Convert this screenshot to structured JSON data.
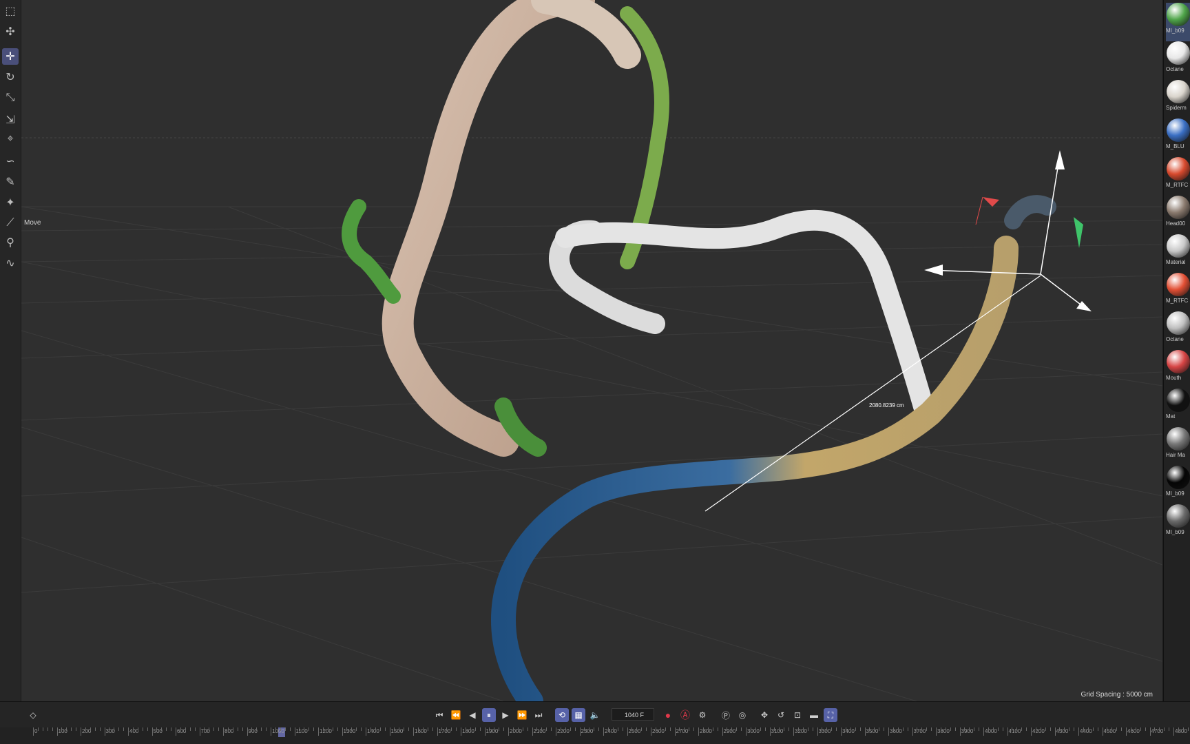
{
  "viewport": {
    "mode_label": "Move",
    "grid_spacing": "Grid Spacing : 5000 cm",
    "measure_readout": "2080.8239 cm"
  },
  "toolbar": {
    "tools": [
      {
        "name": "select-icon",
        "glyph": "⬚"
      },
      {
        "name": "transform-icon",
        "glyph": "✣"
      },
      {
        "name": "move-icon",
        "glyph": "✛",
        "active": true
      },
      {
        "name": "rotate-icon",
        "glyph": "↻"
      },
      {
        "name": "scale-icon",
        "glyph": "⤡"
      },
      {
        "name": "axis-icon",
        "glyph": "⇲"
      },
      {
        "name": "snap-icon",
        "glyph": "⌖"
      },
      {
        "name": "spline-icon",
        "glyph": "∽"
      },
      {
        "name": "pen-icon",
        "glyph": "✎"
      },
      {
        "name": "paint-icon",
        "glyph": "✦"
      },
      {
        "name": "brush-icon",
        "glyph": "⟋"
      },
      {
        "name": "knife-icon",
        "glyph": "⚲"
      },
      {
        "name": "magnet-icon",
        "glyph": "∿"
      }
    ]
  },
  "materials": [
    {
      "label": "MI_b09",
      "color": "#4fa54a",
      "selected": true
    },
    {
      "label": "Octane",
      "color": "#e8e8e8"
    },
    {
      "label": "Spiderm",
      "color": "#d9d4cc"
    },
    {
      "label": "M_BLU",
      "color": "#3a6fc4"
    },
    {
      "label": "M_RTFC",
      "color": "#d84a2e"
    },
    {
      "label": "Head00",
      "color": "#8a7a6e"
    },
    {
      "label": "Material",
      "color": "#c8c8c8"
    },
    {
      "label": "M_RTFC",
      "color": "#e24f34"
    },
    {
      "label": "Octane",
      "color": "#bfbfbf"
    },
    {
      "label": "Mouth",
      "color": "#d64444"
    },
    {
      "label": "Mat",
      "color": "#111111"
    },
    {
      "label": "Hair Ma",
      "color": "#777777"
    },
    {
      "label": "MI_b09",
      "color": "#050505"
    },
    {
      "label": "MI_b09",
      "color": "#6a6a6a"
    }
  ],
  "transport": {
    "frame": "1040 F",
    "buttons": [
      {
        "name": "keyframe-icon",
        "glyph": "◇"
      },
      {
        "name": "go-to-start-icon",
        "glyph": "⏮"
      },
      {
        "name": "prev-key-icon",
        "glyph": "⏪"
      },
      {
        "name": "prev-frame-icon",
        "glyph": "◀"
      },
      {
        "name": "pause-icon",
        "glyph": "⏸",
        "hl": true
      },
      {
        "name": "play-icon",
        "glyph": "▶"
      },
      {
        "name": "next-key-icon",
        "glyph": "⏩"
      },
      {
        "name": "go-to-end-icon",
        "glyph": "⏭"
      },
      {
        "name": "loop-icon",
        "glyph": "⟲",
        "hl": true
      },
      {
        "name": "film-icon",
        "glyph": "▦",
        "hl": true
      },
      {
        "name": "sound-icon",
        "glyph": "🔈"
      },
      {
        "name": "record-icon",
        "glyph": "●",
        "rec": true
      },
      {
        "name": "autokey-icon",
        "glyph": "Ⓐ",
        "rec": true
      },
      {
        "name": "keyframe-settings-icon",
        "glyph": "⚙"
      },
      {
        "name": "key-pos-icon",
        "glyph": "Ⓟ"
      },
      {
        "name": "key-rot-icon",
        "glyph": "◎"
      },
      {
        "name": "key-move-icon",
        "glyph": "✥"
      },
      {
        "name": "key-rotate-icon",
        "glyph": "↺"
      },
      {
        "name": "key-scale-icon",
        "glyph": "⊡"
      },
      {
        "name": "key-param-icon",
        "glyph": "▬"
      },
      {
        "name": "key-pla-icon",
        "glyph": "⛶",
        "hl": true
      }
    ],
    "ruler_labels": [
      "0",
      "100",
      "200",
      "300",
      "400",
      "500",
      "600",
      "700",
      "800",
      "900",
      "1000",
      "1100",
      "1200",
      "1300",
      "1400",
      "1500",
      "1600",
      "1700",
      "1800",
      "1900",
      "2000",
      "2100",
      "2200",
      "2300",
      "2400",
      "2500",
      "2600",
      "2700",
      "2800",
      "2900",
      "3000",
      "3100",
      "3200",
      "3300",
      "3400",
      "3500",
      "3600",
      "3700",
      "3800",
      "3900",
      "4000",
      "4100",
      "4200",
      "4300",
      "4400",
      "4500",
      "4600",
      "4700",
      "4800",
      "4900"
    ]
  }
}
